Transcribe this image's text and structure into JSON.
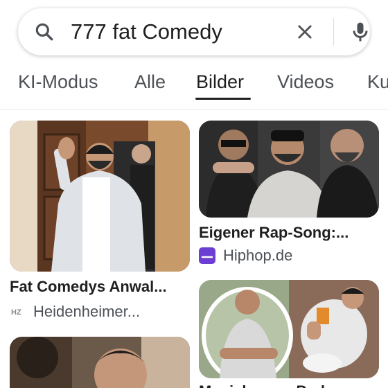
{
  "search": {
    "query": "777 fat Comedy"
  },
  "tabs": [
    {
      "label": "KI-Modus"
    },
    {
      "label": "Alle"
    },
    {
      "label": "Bilder",
      "active": true
    },
    {
      "label": "Videos"
    },
    {
      "label": "Ku"
    }
  ],
  "results": [
    {
      "title": "Fat Comedys Anwal...",
      "source": "Heidenheimer...",
      "favicon_text": "HZ"
    },
    {
      "title": "Eigener Rap-Song:...",
      "source": "Hiphop.de",
      "favicon_color": "#6b3fd4"
    },
    {
      "title": "",
      "source": ""
    },
    {
      "title": "Musiclounge Podca...",
      "source": ""
    }
  ],
  "colors": {
    "accent": "#1f1f1f",
    "tab_text": "#4d5156",
    "hiphop_brand": "#6b3fd4"
  },
  "icons": [
    "search-icon",
    "clear-icon",
    "mic-icon"
  ]
}
